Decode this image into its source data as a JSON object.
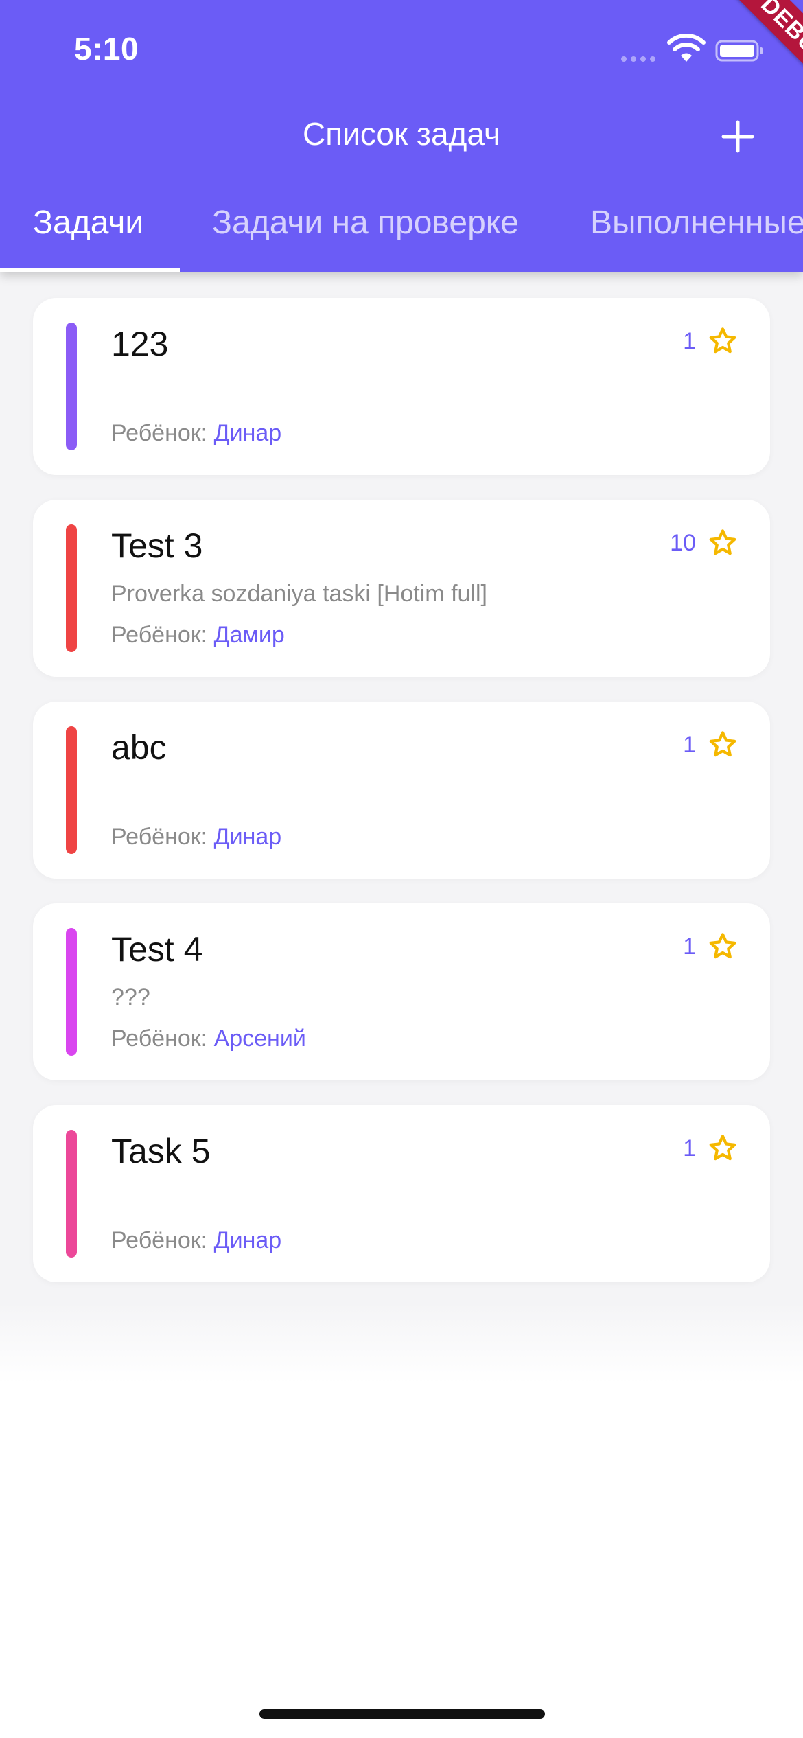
{
  "status_bar": {
    "time": "5:10"
  },
  "debug_banner": "DEBUG",
  "header": {
    "title": "Список задач",
    "add_icon": "plus-icon"
  },
  "tabs": [
    {
      "label": "Задачи",
      "active": true
    },
    {
      "label": "Задачи на проверке",
      "active": false
    },
    {
      "label": "Выполненные",
      "active": false
    }
  ],
  "child_label": "Ребёнок:",
  "tasks": [
    {
      "title": "123",
      "description": "",
      "child": "Динар",
      "points": "1",
      "color": "#8B5CF6"
    },
    {
      "title": "Test 3",
      "description": "Proverka sozdaniya taski [Hotim full]",
      "child": "Дамир",
      "points": "10",
      "color": "#EF4444"
    },
    {
      "title": "abc",
      "description": "",
      "child": "Динар",
      "points": "1",
      "color": "#EF4444"
    },
    {
      "title": "Test 4",
      "description": "???",
      "child": "Арсений",
      "points": "1",
      "color": "#D946EF"
    },
    {
      "title": "Task 5",
      "description": "",
      "child": "Динар",
      "points": "1",
      "color": "#EC4899"
    }
  ],
  "colors": {
    "primary": "#6B5CF6",
    "star": "#F5B800",
    "debug": "#B4163C"
  }
}
